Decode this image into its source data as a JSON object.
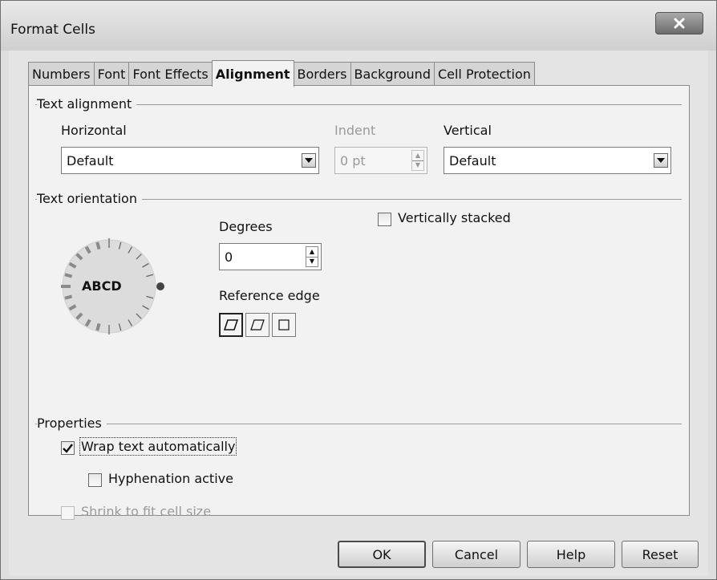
{
  "window": {
    "title": "Format Cells",
    "close_glyph": "X"
  },
  "tabs": [
    {
      "label": "Numbers",
      "active": false
    },
    {
      "label": "Font",
      "active": false
    },
    {
      "label": "Font Effects",
      "active": false
    },
    {
      "label": "Alignment",
      "active": true
    },
    {
      "label": "Borders",
      "active": false
    },
    {
      "label": "Background",
      "active": false
    },
    {
      "label": "Cell Protection",
      "active": false
    }
  ],
  "text_alignment": {
    "group_title": "Text alignment",
    "horizontal_label": "Horizontal",
    "horizontal_value": "Default",
    "indent_label": "Indent",
    "indent_value": "0 pt",
    "vertical_label": "Vertical",
    "vertical_value": "Default"
  },
  "text_orientation": {
    "group_title": "Text orientation",
    "dial_text": "ABCD",
    "degrees_label": "Degrees",
    "degrees_value": "0",
    "reference_edge_label": "Reference edge",
    "vertically_stacked_label": "Vertically stacked",
    "vertically_stacked_checked": false
  },
  "properties": {
    "group_title": "Properties",
    "wrap_label": "Wrap text automatically",
    "wrap_checked": true,
    "hyphenation_label": "Hyphenation active",
    "hyphenation_checked": false,
    "shrink_label": "Shrink to fit cell size",
    "shrink_checked": false
  },
  "buttons": {
    "ok": "OK",
    "cancel": "Cancel",
    "help": "Help",
    "reset": "Reset"
  }
}
